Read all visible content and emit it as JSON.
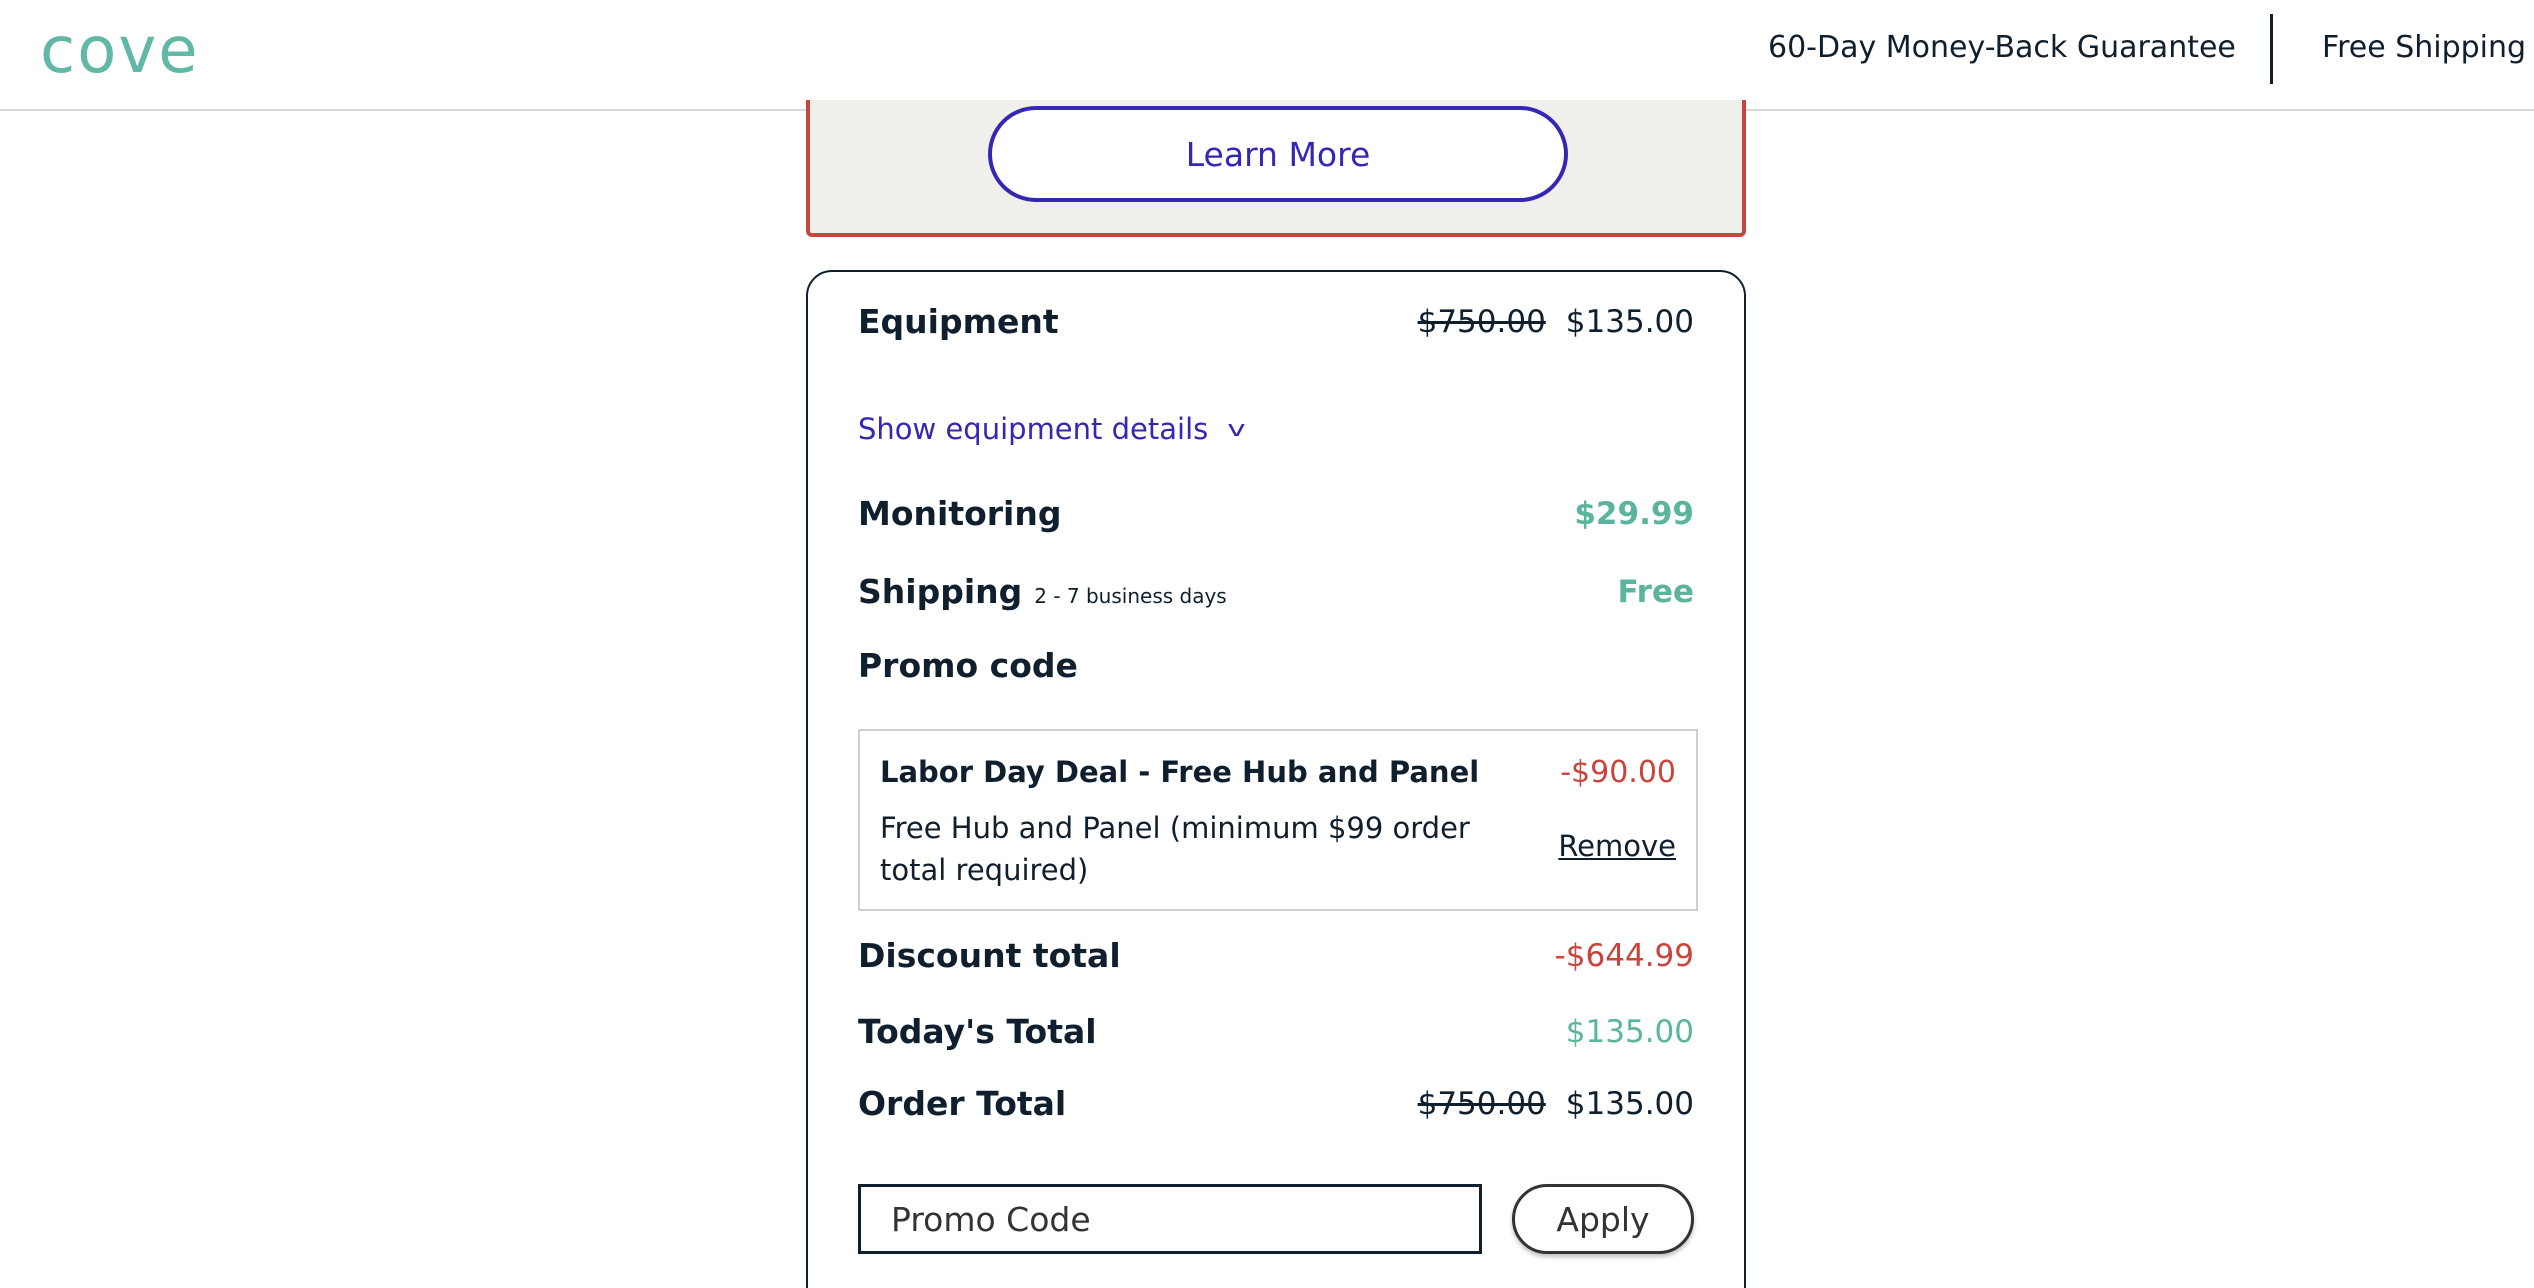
{
  "header": {
    "logo": "cove",
    "guarantee": "60-Day Money-Back Guarantee",
    "shipping": "Free Shipping"
  },
  "promo_banner": {
    "learn_more": "Learn More"
  },
  "summary": {
    "equipment": {
      "label": "Equipment",
      "original_price": "$750.00",
      "price": "$135.00"
    },
    "details_link": "Show equipment details",
    "details_icon": "chevron-down-icon",
    "monitoring": {
      "label": "Monitoring",
      "price": "$29.99"
    },
    "shipping": {
      "label": "Shipping",
      "subtext": "2 - 7 business days",
      "price": "Free"
    },
    "promo_heading": "Promo code",
    "applied_promo": {
      "title": "Labor Day Deal - Free Hub and Panel",
      "amount": "-$90.00",
      "description": "Free Hub and Panel (minimum $99 order total required)",
      "remove": "Remove"
    },
    "discount_total": {
      "label": "Discount total",
      "value": "-$644.99"
    },
    "todays_total": {
      "label": "Today's Total",
      "value": "$135.00"
    },
    "order_total": {
      "label": "Order Total",
      "original_price": "$750.00",
      "price": "$135.00"
    },
    "promo_input": {
      "placeholder": "Promo Code",
      "value": ""
    },
    "apply": "Apply"
  },
  "colors": {
    "teal": "#5bb49e",
    "red": "#c9443a",
    "indigo": "#3427b3",
    "navy": "#0f1f2e"
  }
}
